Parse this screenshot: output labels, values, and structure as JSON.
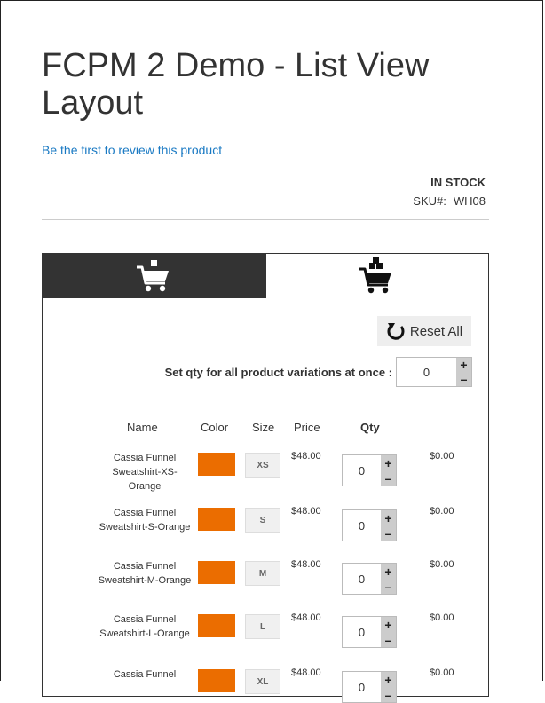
{
  "product": {
    "title": "FCPM 2 Demo - List View Layout",
    "review_link": "Be the first to review this product",
    "stock_status": "IN STOCK",
    "sku_label": "SKU#:",
    "sku_value": "WH08"
  },
  "tabs": [
    {
      "icon": "single-cart-icon",
      "active": false
    },
    {
      "icon": "bulk-cart-icon",
      "active": true
    }
  ],
  "controls": {
    "reset_label": "Reset All",
    "set_qty_label": "Set qty for all product variations at once :",
    "global_qty": "0",
    "plus": "+",
    "minus": "–"
  },
  "table": {
    "headers": [
      "Name",
      "Color",
      "Size",
      "Price",
      "Qty"
    ],
    "rows": [
      {
        "name": "Cassia Funnel Sweatshirt-XS-Orange",
        "color": "#eb6d00",
        "size": "XS",
        "price": "$48.00",
        "qty": "0",
        "total": "$0.00"
      },
      {
        "name": "Cassia Funnel Sweatshirt-S-Orange",
        "color": "#eb6d00",
        "size": "S",
        "price": "$48.00",
        "qty": "0",
        "total": "$0.00"
      },
      {
        "name": "Cassia Funnel Sweatshirt-M-Orange",
        "color": "#eb6d00",
        "size": "M",
        "price": "$48.00",
        "qty": "0",
        "total": "$0.00"
      },
      {
        "name": "Cassia Funnel Sweatshirt-L-Orange",
        "color": "#eb6d00",
        "size": "L",
        "price": "$48.00",
        "qty": "0",
        "total": "$0.00"
      },
      {
        "name": "Cassia Funnel",
        "color": "#eb6d00",
        "size": "XL",
        "price": "$48.00",
        "qty": "0",
        "total": "$0.00"
      }
    ]
  },
  "colors": {
    "link": "#1979c3",
    "dark_tab": "#333333",
    "swatch_orange": "#eb6d00"
  }
}
